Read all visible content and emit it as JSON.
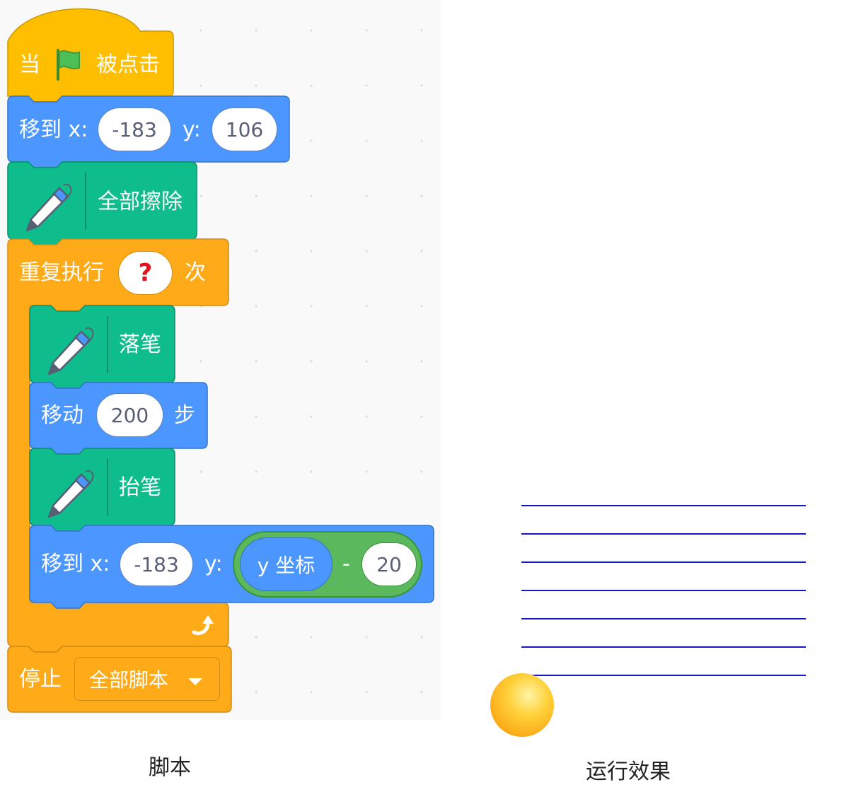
{
  "script": {
    "hat": {
      "when": "当",
      "clicked": "被点击",
      "flag": "green-flag-icon"
    },
    "goto1": {
      "label": "移到 x:",
      "x": "-183",
      "ylabel": "y:",
      "y": "106"
    },
    "erase": {
      "label": "全部擦除",
      "icon": "pen-icon"
    },
    "repeat": {
      "label": "重复执行",
      "times": "?",
      "suffix": "次",
      "loop_icon": "loop-arrow-icon"
    },
    "pendown": {
      "label": "落笔"
    },
    "move": {
      "label": "移动",
      "steps": "200",
      "suffix": "步"
    },
    "penup": {
      "label": "抬笔"
    },
    "goto2": {
      "label": "移到 x:",
      "x": "-183",
      "ylabel": "y:",
      "yvar": "y 坐标",
      "minus": "-",
      "delta": "20"
    },
    "stop": {
      "label": "停止",
      "option": "全部脚本"
    }
  },
  "captions": {
    "script": "脚本",
    "result": "运行效果"
  },
  "stage": {
    "line_color": "#1414c8",
    "line_count": 7,
    "sprite": "ball-sprite"
  },
  "colors": {
    "events": "#ffbf00",
    "motion": "#4c97ff",
    "pen": "#0fbd8c",
    "control": "#ffab19",
    "operators": "#59c059"
  }
}
